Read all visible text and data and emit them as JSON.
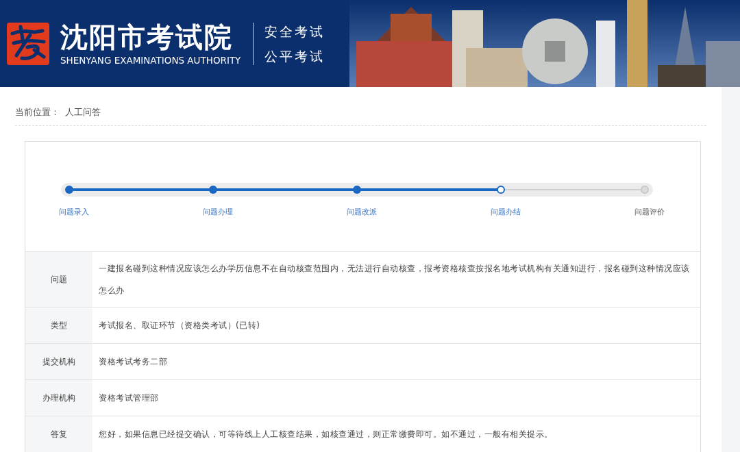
{
  "header": {
    "title": "沈阳市考试院",
    "subtitle": "SHENYANG EXAMINATIONS AUTHORITY",
    "slogans": [
      "安全考试",
      "公平考试"
    ]
  },
  "breadcrumb": {
    "label": "当前位置：",
    "current": "人工问答"
  },
  "progress": {
    "level": 0.75,
    "steps": [
      {
        "label": "问题录入",
        "done": true,
        "current": false
      },
      {
        "label": "问题办理",
        "done": true,
        "current": false
      },
      {
        "label": "问题改派",
        "done": true,
        "current": false
      },
      {
        "label": "问题办结",
        "done": false,
        "current": true
      },
      {
        "label": "问题评价",
        "done": false,
        "current": false
      }
    ]
  },
  "details": [
    {
      "label": "问题",
      "value": "一建报名碰到这种情况应该怎么办学历信息不在自动核查范围内，无法进行自动核查，报考资格核查按报名地考试机构有关通知进行，报名碰到这种情况应该怎么办"
    },
    {
      "label": "类型",
      "value": "考试报名、取证环节（资格类考试）(已转)"
    },
    {
      "label": "提交机构",
      "value": "资格考试考务二部"
    },
    {
      "label": "办理机构",
      "value": "资格考试管理部"
    },
    {
      "label": "答复",
      "value": "您好，如果信息已经提交确认，可等待线上人工核查结果，如核查通过，则正常缴费即可。如不通过，一般有相关提示。"
    }
  ]
}
